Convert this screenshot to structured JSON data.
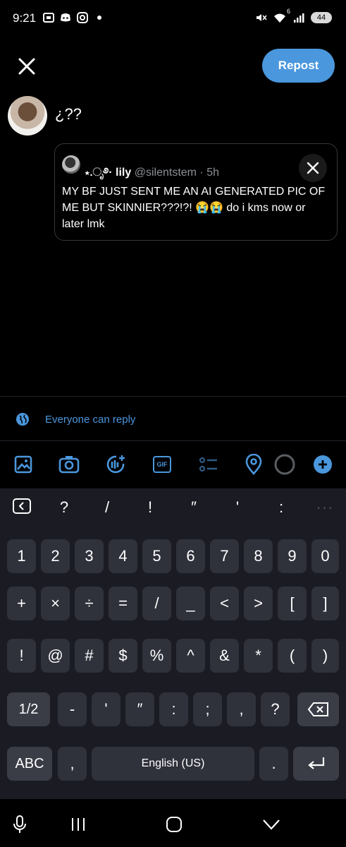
{
  "status": {
    "time": "9:21",
    "battery": "44",
    "wifi_badge": "6"
  },
  "header": {
    "repost_label": "Repost"
  },
  "compose": {
    "text": "¿??"
  },
  "quote": {
    "name_prefix": "⋆.ೃ࿔·",
    "name": "lily",
    "handle": "@silentstem",
    "sep": " · ",
    "age": "5h",
    "body": "MY BF JUST SENT ME AN AI GENERATED PIC OF ME BUT SKINNIER???!?! 😭😭 do i kms now or later lmk"
  },
  "reply": {
    "label": "Everyone can reply"
  },
  "toolbar": {
    "gif": "GIF"
  },
  "keyboard": {
    "top_keys": [
      "?",
      "/",
      "!",
      "″",
      "'",
      ":"
    ],
    "row1": [
      "1",
      "2",
      "3",
      "4",
      "5",
      "6",
      "7",
      "8",
      "9",
      "0"
    ],
    "row2": [
      "+",
      "×",
      "÷",
      "=",
      "/",
      "_",
      "<",
      ">",
      "[",
      "]"
    ],
    "row3": [
      "!",
      "@",
      "#",
      "$",
      "%",
      "^",
      "&",
      "*",
      "(",
      ")"
    ],
    "row4": [
      "1/2",
      "-",
      "'",
      "″",
      ":",
      ";",
      ",",
      "?"
    ],
    "row5": {
      "abc": "ABC",
      "comma": ",",
      "space": "English (US)",
      "period": "."
    }
  },
  "colors": {
    "accent": "#4a97dd",
    "background": "#000000",
    "key": "#2f313b"
  }
}
